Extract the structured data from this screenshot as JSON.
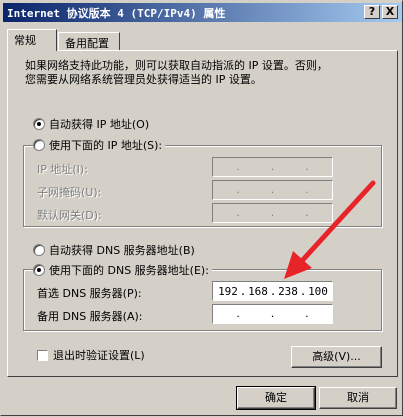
{
  "window": {
    "title": "Internet 协议版本 4 (TCP/IPv4) 属性",
    "help_button": "?",
    "close_button": "X"
  },
  "tabs": [
    {
      "label": "常规",
      "active": true
    },
    {
      "label": "备用配置",
      "active": false
    }
  ],
  "description": {
    "line1": "如果网络支持此功能，则可以获取自动指派的 IP 设置。否则，",
    "line2": "您需要从网络系统管理员处获得适当的 IP 设置。"
  },
  "ip_section": {
    "auto_radio": "自动获得 IP 地址(O)",
    "manual_radio": "使用下面的 IP 地址(S):",
    "selected": "auto",
    "fields": [
      {
        "label": "IP 地址(I):",
        "value": ""
      },
      {
        "label": "子网掩码(U):",
        "value": ""
      },
      {
        "label": "默认网关(D):",
        "value": ""
      }
    ]
  },
  "dns_section": {
    "auto_radio": "自动获得 DNS 服务器地址(B)",
    "manual_radio": "使用下面的 DNS 服务器地址(E):",
    "selected": "manual",
    "preferred": {
      "label": "首选 DNS 服务器(P):",
      "octets": [
        "192",
        "168",
        "238",
        "100"
      ]
    },
    "alternate": {
      "label": "备用 DNS 服务器(A):",
      "octets": [
        "",
        "",
        "",
        ""
      ]
    }
  },
  "validate_checkbox": {
    "label": "退出时验证设置(L)",
    "checked": false
  },
  "advanced_button": "高级(V)...",
  "ok_button": "确定",
  "cancel_button": "取消",
  "annotation": {
    "type": "arrow",
    "color": "#e8242b"
  }
}
